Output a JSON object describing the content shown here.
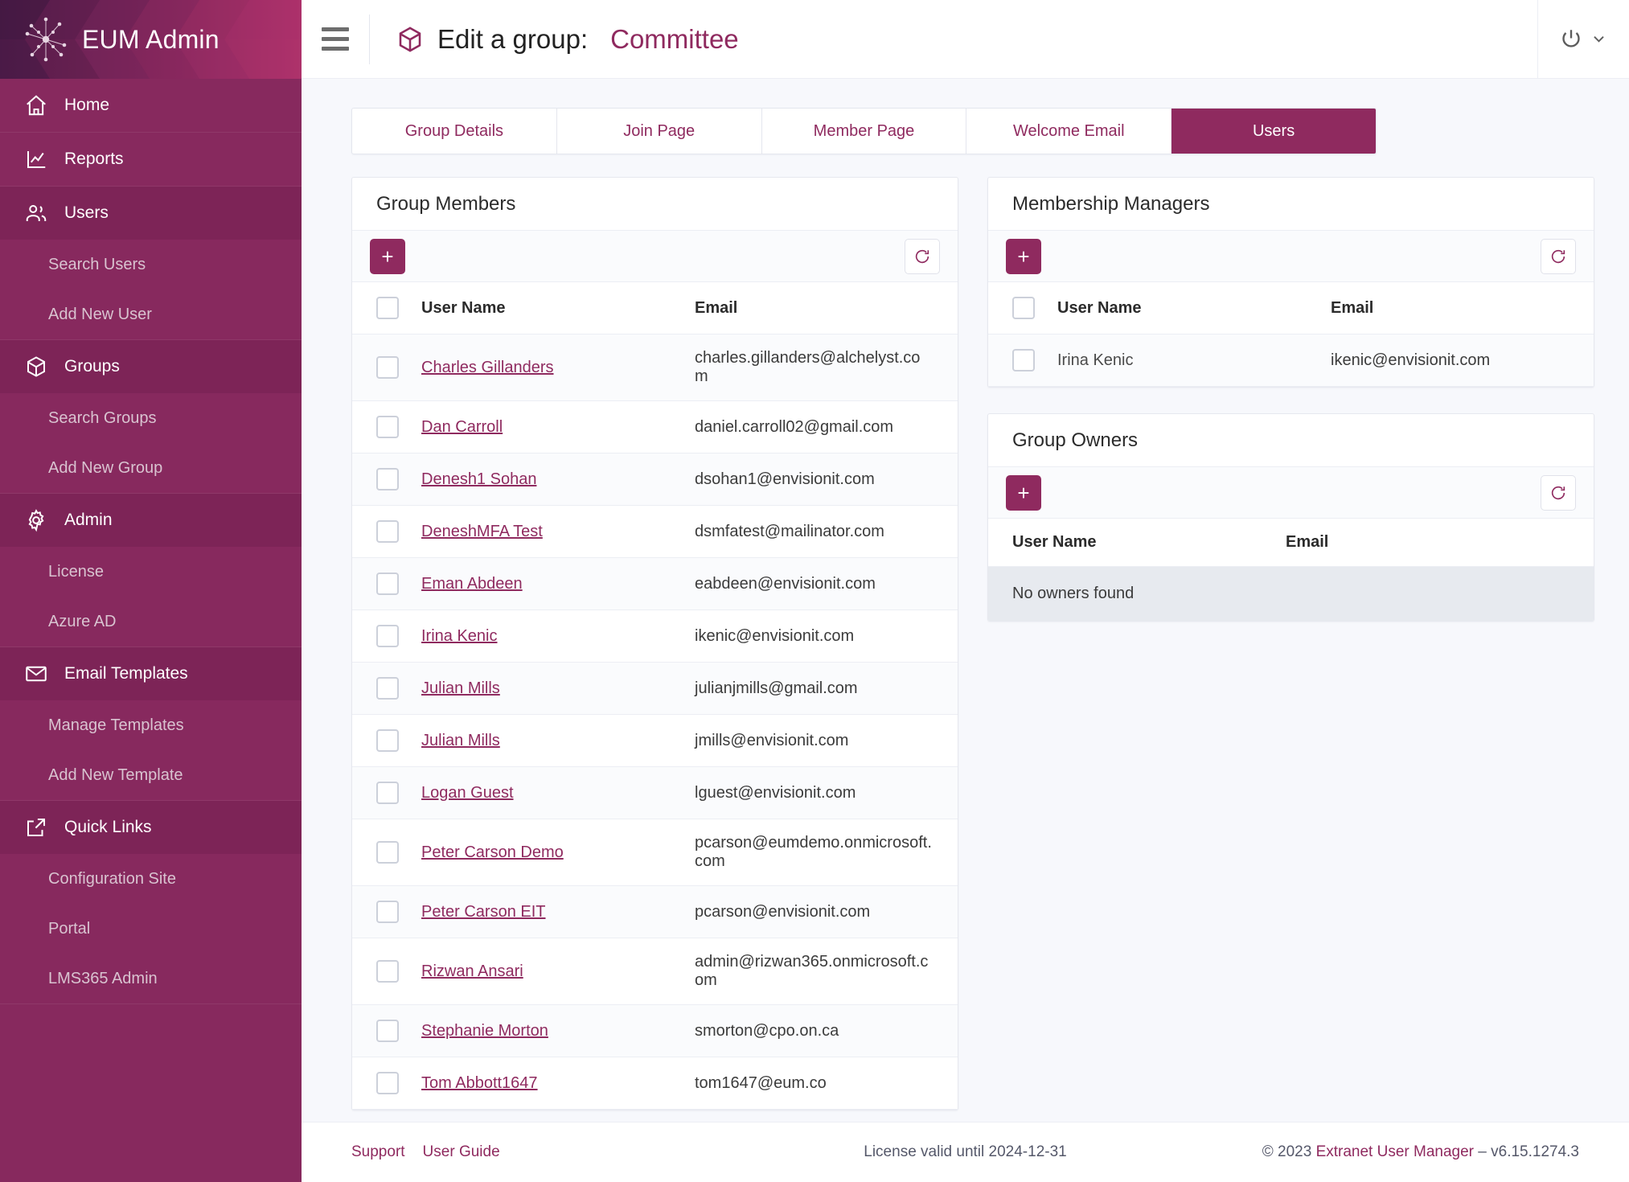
{
  "brand": {
    "title": "EUM Admin",
    "logo_icon": "network-star-icon"
  },
  "sidebar": {
    "groups": [
      {
        "label": "Home",
        "icon": "home-icon",
        "active": false,
        "children": []
      },
      {
        "label": "Reports",
        "icon": "chart-line-icon",
        "active": false,
        "children": []
      },
      {
        "label": "Users",
        "icon": "users-icon",
        "active": true,
        "children": [
          "Search Users",
          "Add New User"
        ]
      },
      {
        "label": "Groups",
        "icon": "cube-icon",
        "active": true,
        "children": [
          "Search Groups",
          "Add New Group"
        ]
      },
      {
        "label": "Admin",
        "icon": "gear-icon",
        "active": true,
        "children": [
          "License",
          "Azure AD"
        ]
      },
      {
        "label": "Email Templates",
        "icon": "envelope-icon",
        "active": true,
        "children": [
          "Manage Templates",
          "Add New Template"
        ]
      },
      {
        "label": "Quick Links",
        "icon": "external-link-icon",
        "active": true,
        "children": [
          "Configuration Site",
          "Portal",
          "LMS365 Admin"
        ]
      }
    ]
  },
  "topbar": {
    "menu_icon": "hamburger-icon",
    "page_icon": "cube-icon",
    "title_prefix": "Edit a group:",
    "group_name": "Committee",
    "power_icon": "power-icon",
    "chevron_icon": "chevron-down-icon"
  },
  "tabs": [
    {
      "label": "Group Details",
      "active": false
    },
    {
      "label": "Join Page",
      "active": false
    },
    {
      "label": "Member Page",
      "active": false
    },
    {
      "label": "Welcome Email",
      "active": false
    },
    {
      "label": "Users",
      "active": true
    }
  ],
  "group_members": {
    "title": "Group Members",
    "add_label": "+",
    "add_icon": "plus-icon",
    "refresh_icon": "refresh-icon",
    "columns": [
      "User Name",
      "Email"
    ],
    "rows": [
      {
        "name": "Charles Gillanders",
        "email": "charles.gillanders@alchelyst.com"
      },
      {
        "name": "Dan Carroll",
        "email": "daniel.carroll02@gmail.com"
      },
      {
        "name": "Denesh1 Sohan",
        "email": "dsohan1@envisionit.com"
      },
      {
        "name": "DeneshMFA Test",
        "email": "dsmfatest@mailinator.com"
      },
      {
        "name": "Eman Abdeen",
        "email": "eabdeen@envisionit.com"
      },
      {
        "name": "Irina Kenic",
        "email": "ikenic@envisionit.com"
      },
      {
        "name": "Julian Mills",
        "email": "julianjmills@gmail.com"
      },
      {
        "name": "Julian Mills",
        "email": "jmills@envisionit.com"
      },
      {
        "name": "Logan Guest",
        "email": "lguest@envisionit.com"
      },
      {
        "name": "Peter Carson Demo",
        "email": "pcarson@eumdemo.onmicrosoft.com"
      },
      {
        "name": "Peter Carson EIT",
        "email": "pcarson@envisionit.com"
      },
      {
        "name": "Rizwan Ansari",
        "email": "admin@rizwan365.onmicrosoft.com"
      },
      {
        "name": "Stephanie Morton",
        "email": "smorton@cpo.on.ca"
      },
      {
        "name": "Tom Abbott1647",
        "email": "tom1647@eum.co"
      }
    ]
  },
  "membership_managers": {
    "title": "Membership Managers",
    "add_label": "+",
    "add_icon": "plus-icon",
    "refresh_icon": "refresh-icon",
    "columns": [
      "User Name",
      "Email"
    ],
    "rows": [
      {
        "name": "Irina Kenic",
        "email": "ikenic@envisionit.com"
      }
    ]
  },
  "group_owners": {
    "title": "Group Owners",
    "add_label": "+",
    "add_icon": "plus-icon",
    "refresh_icon": "refresh-icon",
    "columns": [
      "User Name",
      "Email"
    ],
    "rows": [],
    "empty_text": "No owners found"
  },
  "footer": {
    "support": "Support",
    "user_guide": "User Guide",
    "license": "License valid until 2024-12-31",
    "copyright_prefix": "© 2023 ",
    "product": "Extranet User Manager",
    "version": " – v6.15.1274.3"
  },
  "colors": {
    "brand": "#87295e",
    "accent": "#8f2a5f",
    "sidebar_active": "#7d2457",
    "page_bg": "#f7f8fc",
    "empty_row_bg": "#e7eaef"
  }
}
